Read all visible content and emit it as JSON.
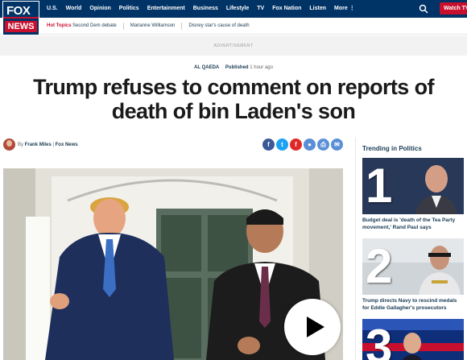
{
  "logo": {
    "line1": "FOX",
    "line2": "NEWS"
  },
  "nav": {
    "items": [
      "U.S.",
      "World",
      "Opinion",
      "Politics",
      "Entertainment",
      "Business",
      "Lifestyle",
      "TV",
      "Fox Nation",
      "Listen",
      "More"
    ],
    "more_dots": "⋮",
    "watch_tv": "Watch TV"
  },
  "hot_topics": {
    "label": "Hot Topics",
    "items": [
      "Second Dem debate",
      "Marianne Williamson",
      "Disney star's cause of death"
    ]
  },
  "ad": {
    "label": "ADVERTISEMENT"
  },
  "article": {
    "category": "AL QAEDA",
    "published_label": "Published",
    "published_time": "1 hour ago",
    "headline": "Trump refuses to comment on reports of death of bin Laden's son",
    "byline_prefix": "By",
    "author": "Frank Miles",
    "outlet": "Fox News"
  },
  "share_icons": [
    "facebook-icon",
    "twitter-icon",
    "flipboard-icon",
    "comments-icon",
    "print-icon",
    "email-icon"
  ],
  "share_glyphs": [
    "f",
    "t",
    "f",
    "●",
    "⎙",
    "✉"
  ],
  "colors": {
    "brand_navy": "#003366",
    "brand_red": "#c8102e",
    "facebook": "#3b5998",
    "twitter": "#1da1f2",
    "flipboard": "#e12828",
    "comments": "#5a8fd6",
    "print": "#5a8fd6",
    "email": "#5a8fd6"
  },
  "sidebar": {
    "title": "Trending in Politics",
    "items": [
      {
        "number": "1",
        "text": "Budget deal is 'death of the Tea Party movement,' Rand Paul says"
      },
      {
        "number": "2",
        "text": "Trump directs Navy to rescind medals for Eddie Gallagher's prosecutors"
      },
      {
        "number": "3",
        "text": ""
      }
    ]
  }
}
